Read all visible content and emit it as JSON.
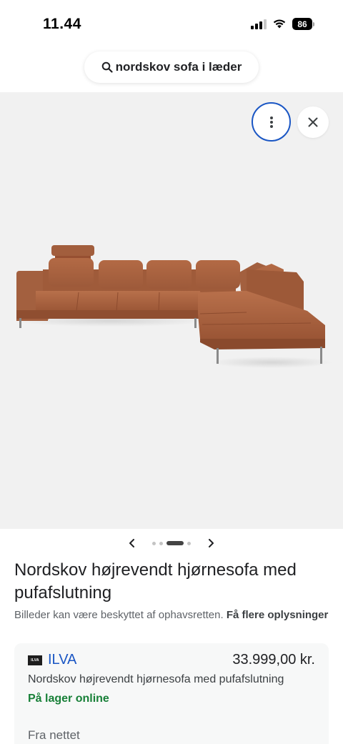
{
  "status_bar": {
    "time": "11.44",
    "battery_level": "86",
    "signal_bars": 4,
    "signal_bars_active": 3
  },
  "search": {
    "query": "nordskov sofa i læder",
    "icon": "search-icon"
  },
  "viewer": {
    "more_icon": "more-vertical-icon",
    "close_icon": "close-icon",
    "image_alt": "Nordskov sofa",
    "carousel": {
      "total": 4,
      "active_index": 2
    }
  },
  "result": {
    "title": "Nordskov højrevendt hjørnesofa med pufafslutning",
    "copyright_text": "Billeder kan være beskyttet af ophavsretten.",
    "copyright_link": "Få flere oplysninger"
  },
  "product_card": {
    "logo_text": "ILVA",
    "store_name": "ILVA",
    "price": "33.999,00 kr.",
    "description": "Nordskov højrevendt hjørnesofa med pufafslutning",
    "stock": "På lager online",
    "source": "Fra nettet"
  },
  "colors": {
    "accent_blue": "#1a56c4",
    "stock_green": "#188038",
    "sofa_leather": "#a9623f"
  }
}
